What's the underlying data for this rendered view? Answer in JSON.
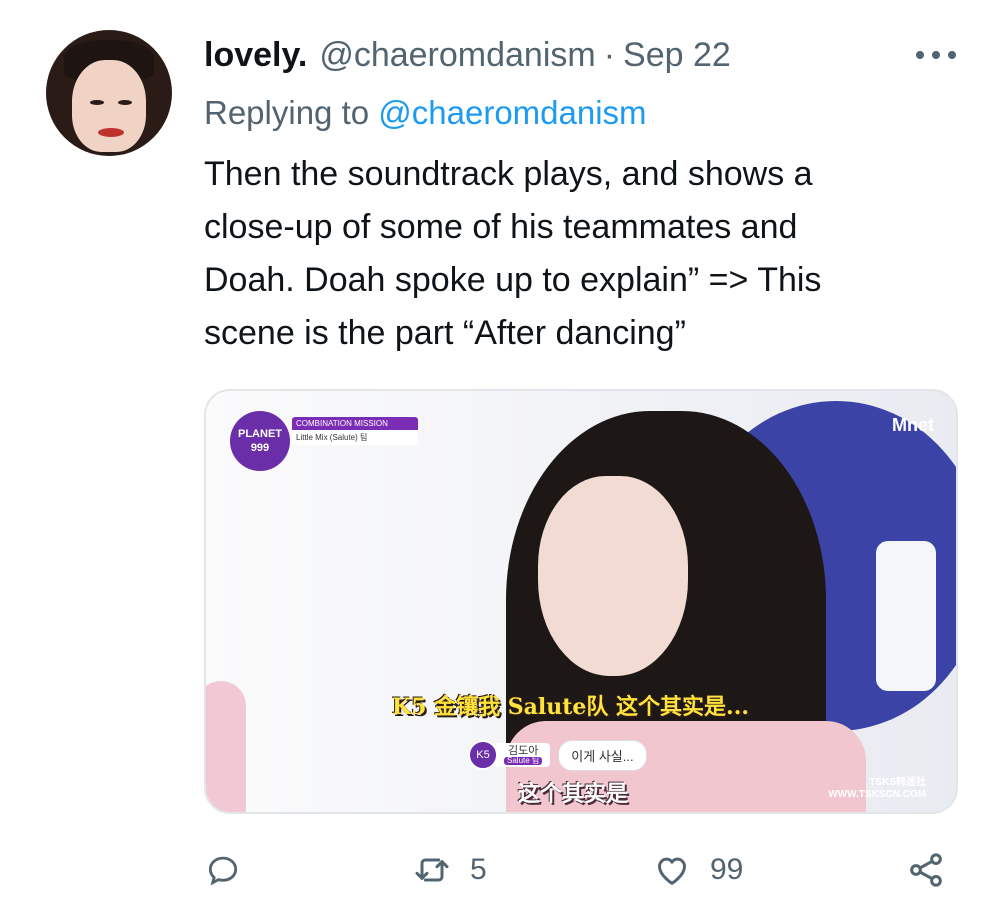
{
  "tweet": {
    "display_name": "lovely.",
    "handle": "@chaeromdanism",
    "separator": "·",
    "date": "Sep 22",
    "replying_prefix": "Replying to",
    "replying_handle": "@chaeromdanism",
    "text_lines": [
      "Then the soundtrack plays, and shows a",
      "close-up of some of his teammates and",
      "Doah.  Doah spoke up to explain” => This",
      "scene is the part “After dancing”"
    ]
  },
  "media": {
    "show_logo_line1": "PLANET",
    "show_logo_line2": "999",
    "mission_title": "COMBINATION MISSION",
    "mission_team": "Little Mix (Salute) 팀",
    "channel_logo": "Mnet",
    "subtitle_cn_top": "K5 金镶我 Salute队 这个其实是...",
    "caption_badge": "K5",
    "caption_name": "김도아",
    "caption_team": "Salute 팀",
    "caption_speech": "이게 사실...",
    "subtitle_cn_bottom": "这个其实是",
    "watermark_line1": "TSKS韩迷社",
    "watermark_line2": "WWW.TSKSCN.COM"
  },
  "actions": {
    "reply_icon": "reply-icon",
    "retweet_icon": "retweet-icon",
    "retweet_count": "5",
    "like_icon": "heart-icon",
    "like_count": "99",
    "share_icon": "share-icon"
  },
  "colors": {
    "link": "#1d9bf0",
    "secondary_text": "#536471",
    "primary_text": "#0f1419"
  }
}
